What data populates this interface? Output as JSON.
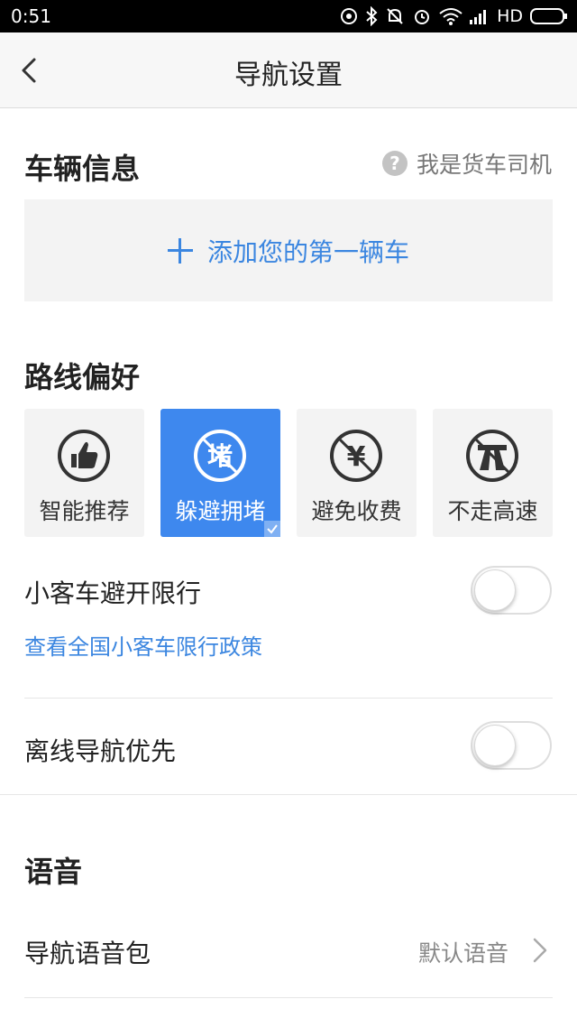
{
  "status_bar": {
    "time": "0:51",
    "network": "HD"
  },
  "nav": {
    "title": "导航设置"
  },
  "vehicle": {
    "section_title": "车辆信息",
    "truck_driver_link": "我是货车司机",
    "add_car_label": "添加您的第一辆车"
  },
  "route": {
    "section_title": "路线偏好",
    "options": [
      {
        "label": "智能推荐",
        "icon": "thumbs-up-icon",
        "selected": false
      },
      {
        "label": "躲避拥堵",
        "icon": "avoid-congestion-icon",
        "selected": true
      },
      {
        "label": "避免收费",
        "icon": "no-toll-icon",
        "selected": false
      },
      {
        "label": "不走高速",
        "icon": "no-highway-icon",
        "selected": false
      }
    ],
    "restriction_label": "小客车避开限行",
    "restriction_on": false,
    "policy_link": "查看全国小客车限行政策",
    "offline_label": "离线导航优先",
    "offline_on": false
  },
  "voice": {
    "section_title": "语音",
    "package_label": "导航语音包",
    "package_value": "默认语音"
  },
  "colors": {
    "accent": "#3e88ee",
    "link": "#3b86e0",
    "card_bg": "#f3f3f3"
  }
}
